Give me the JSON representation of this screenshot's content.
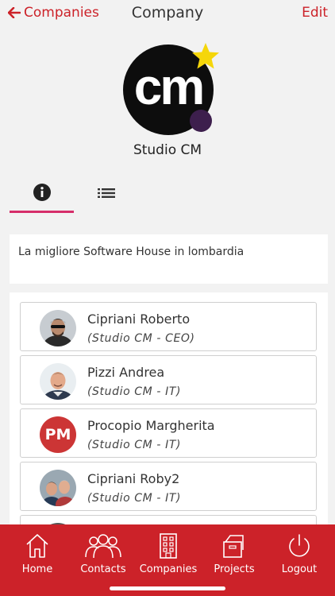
{
  "nav": {
    "back_label": "Companies",
    "title": "Company",
    "edit_label": "Edit"
  },
  "company": {
    "logo_text": "cm",
    "name": "Studio CM",
    "description": "La migliore Software House in lombardia"
  },
  "tabs": [
    {
      "icon": "info-icon",
      "active": true
    },
    {
      "icon": "list-icon",
      "active": false
    }
  ],
  "contacts": [
    {
      "name": "Cipriani Roberto",
      "role": "(Studio CM - CEO)",
      "avatar": "photo"
    },
    {
      "name": "Pizzi Andrea",
      "role": "(Studio CM - IT)",
      "avatar": "photo"
    },
    {
      "name": "Procopio Margherita",
      "role": "(Studio CM - IT)",
      "avatar": "initials",
      "initials": "PM"
    },
    {
      "name": "Cipriani Roby2",
      "role": "(Studio CM - IT)",
      "avatar": "photo"
    }
  ],
  "tabbar": {
    "items": [
      {
        "label": "Home",
        "icon": "home-icon"
      },
      {
        "label": "Contacts",
        "icon": "contacts-icon"
      },
      {
        "label": "Companies",
        "icon": "companies-icon",
        "active": true
      },
      {
        "label": "Projects",
        "icon": "projects-icon"
      },
      {
        "label": "Logout",
        "icon": "power-icon"
      }
    ]
  },
  "colors": {
    "accent": "#cc2229",
    "tab_underline": "#d62e6a",
    "star": "#f5d60a",
    "logo_dot": "#3d1f4d",
    "initials_bg": "#cc3535"
  }
}
